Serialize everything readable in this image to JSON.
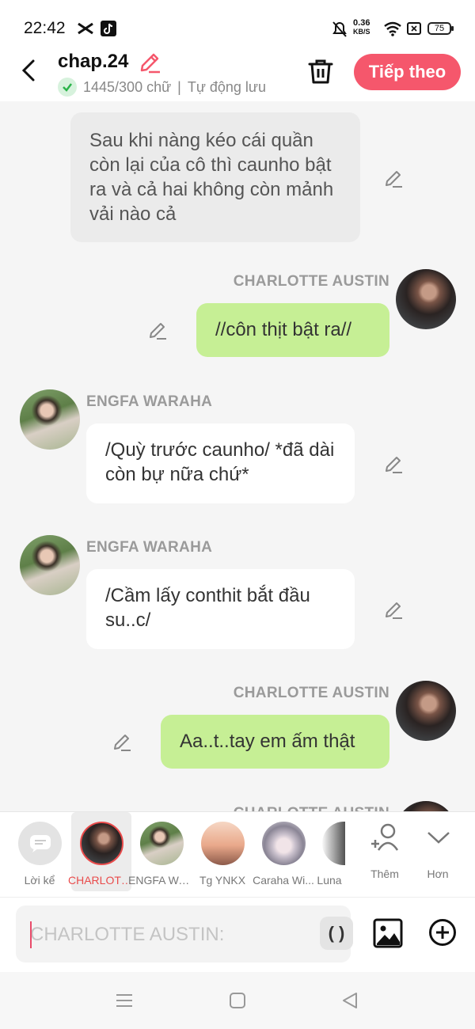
{
  "status_bar": {
    "time": "22:42",
    "net_speed": "0.36",
    "net_unit": "KB/S",
    "battery": "75"
  },
  "header": {
    "title": "chap.24",
    "word_count": "1445/300 chữ",
    "separator": "|",
    "autosave": "Tự động lưu",
    "next_label": "Tiếp theo",
    "accent": "#f5576c"
  },
  "messages": [
    {
      "type": "narration",
      "text": "Sau khi nàng kéo cái quần còn lại của cô thì caunho bật ra và cả hai không còn mảnh vải nào cả"
    },
    {
      "type": "right",
      "speaker": "CHARLOTTE AUSTIN",
      "text": "//côn thịt bật ra//"
    },
    {
      "type": "left",
      "speaker": "ENGFA WARAHA",
      "text": "/Quỳ trước caunho/ *đã dài còn bự nữa chứ*"
    },
    {
      "type": "left",
      "speaker": "ENGFA WARAHA",
      "text": "/Cầm lấy conthit bắt đầu su..c/"
    },
    {
      "type": "right",
      "speaker": "CHARLOTTE AUSTIN",
      "text": "Aa..t..tay em ấm thật"
    },
    {
      "type": "right",
      "speaker": "CHARLOTTE AUSTIN",
      "text": ""
    }
  ],
  "characters": [
    {
      "label": "Lời kể"
    },
    {
      "label": "CHARLOTTE AUSTIN",
      "selected": true
    },
    {
      "label": "ENGFA WARAHA"
    },
    {
      "label": "Tg YNKX"
    },
    {
      "label": "Caraha Wi..."
    },
    {
      "label": "Luna"
    },
    {
      "label": "Thêm"
    },
    {
      "label": "Hơn"
    }
  ],
  "input": {
    "placeholder": "CHARLOTTE AUSTIN:",
    "paren_label": "( )"
  },
  "colors": {
    "bubble_right": "#c6ef95",
    "bubble_left": "#ffffff",
    "narration": "#ebebeb",
    "selected": "#e94b4b"
  }
}
